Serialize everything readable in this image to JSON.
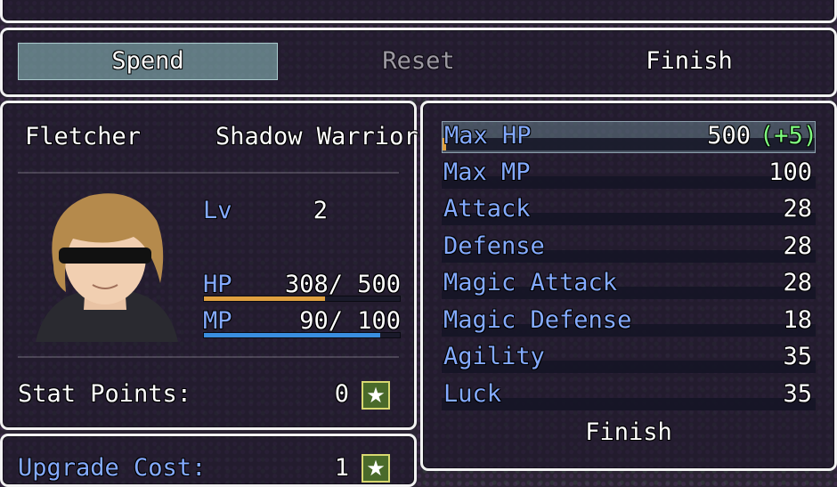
{
  "commands": {
    "spend": "Spend",
    "reset": "Reset",
    "finish": "Finish"
  },
  "actor": {
    "name": "Fletcher",
    "class": "Shadow Warrior",
    "level_label": "Lv",
    "level": "2",
    "hp_label": "HP",
    "hp_value": "308/ 500",
    "hp_fraction": 0.616,
    "mp_label": "MP",
    "mp_value": "90/ 100",
    "mp_fraction": 0.9,
    "stat_points_label": "Stat Points:",
    "stat_points": "0"
  },
  "upgrade": {
    "label": "Upgrade Cost:",
    "value": "1"
  },
  "stats": [
    {
      "name": "Max HP",
      "value": "500",
      "bonus": "(+5)",
      "fill": 0.01
    },
    {
      "name": "Max MP",
      "value": "100",
      "bonus": "",
      "fill": 0
    },
    {
      "name": "Attack",
      "value": "28",
      "bonus": "",
      "fill": 0
    },
    {
      "name": "Defense",
      "value": "28",
      "bonus": "",
      "fill": 0
    },
    {
      "name": "Magic Attack",
      "value": "28",
      "bonus": "",
      "fill": 0
    },
    {
      "name": "Magic Defense",
      "value": "18",
      "bonus": "",
      "fill": 0
    },
    {
      "name": "Agility",
      "value": "35",
      "bonus": "",
      "fill": 0
    },
    {
      "name": "Luck",
      "value": "35",
      "bonus": "",
      "fill": 0
    }
  ],
  "stats_finish": "Finish",
  "colors": {
    "hp_gauge": "#e0a040",
    "mp_gauge": "#3a8ee0",
    "system_text": "#84aaff",
    "bonus_text": "#80ff80"
  }
}
